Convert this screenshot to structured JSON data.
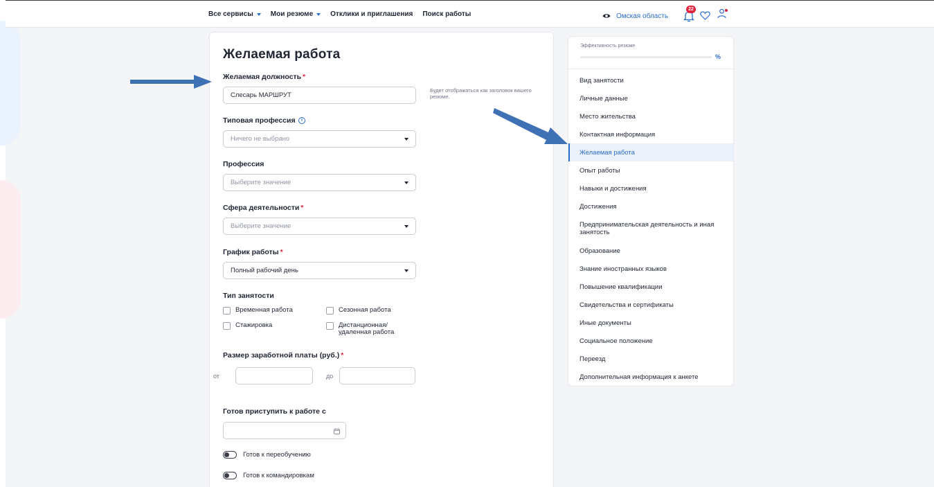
{
  "nav": {
    "items": [
      {
        "label": "Все сервисы",
        "caret": true
      },
      {
        "label": "Мои резюме",
        "caret": true
      },
      {
        "label": "Отклики и приглашения",
        "caret": false
      },
      {
        "label": "Поиск работы",
        "caret": false
      }
    ],
    "region": "Омская область",
    "notifications_count": "22"
  },
  "form": {
    "title": "Желаемая работа",
    "position_label": "Желаемая должность",
    "position_value": "Слесарь МАРШРУТ",
    "position_hint": "Будет отображаться как заголовок вашего резюме.",
    "typical_label": "Типовая профессия",
    "typical_placeholder": "Ничего не выбрано",
    "profession_label": "Профессия",
    "profession_placeholder": "Выберите значение",
    "sphere_label": "Сфера деятельности",
    "sphere_placeholder": "Выберите значение",
    "schedule_label": "График работы",
    "schedule_value": "Полный рабочий день",
    "employment_label": "Тип занятости",
    "employment_options": [
      "Временная работа",
      "Сезонная работа",
      "Стажировка",
      "Дистанционная/ удаленная работа"
    ],
    "salary_label": "Размер заработной платы (руб.)",
    "salary_from": "от",
    "salary_to": "до",
    "start_label": "Готов приступить к работе с",
    "toggle_retrain": "Готов к переобучению",
    "toggle_trips": "Готов к командировкам",
    "required_mark": "*"
  },
  "sidebar": {
    "efficiency_label": "Эффективность резюме",
    "efficiency_pct": "%",
    "items": [
      "Вид занятости",
      "Личные данные",
      "Место жительства",
      "Контактная информация",
      "Желаемая работа",
      "Опыт работы",
      "Навыки и достижения",
      "Достижения",
      "Предпринимательская деятельность и иная занятость",
      "Образование",
      "Знание иностранных языков",
      "Повышение квалификации",
      "Свидетельства и сертификаты",
      "Иные документы",
      "Социальное положение",
      "Переезд",
      "Дополнительная информация к анкете"
    ],
    "active_index": 4
  },
  "colors": {
    "accent": "#2b6cd0",
    "required": "#e2223b",
    "arrow": "#3f72b5"
  }
}
